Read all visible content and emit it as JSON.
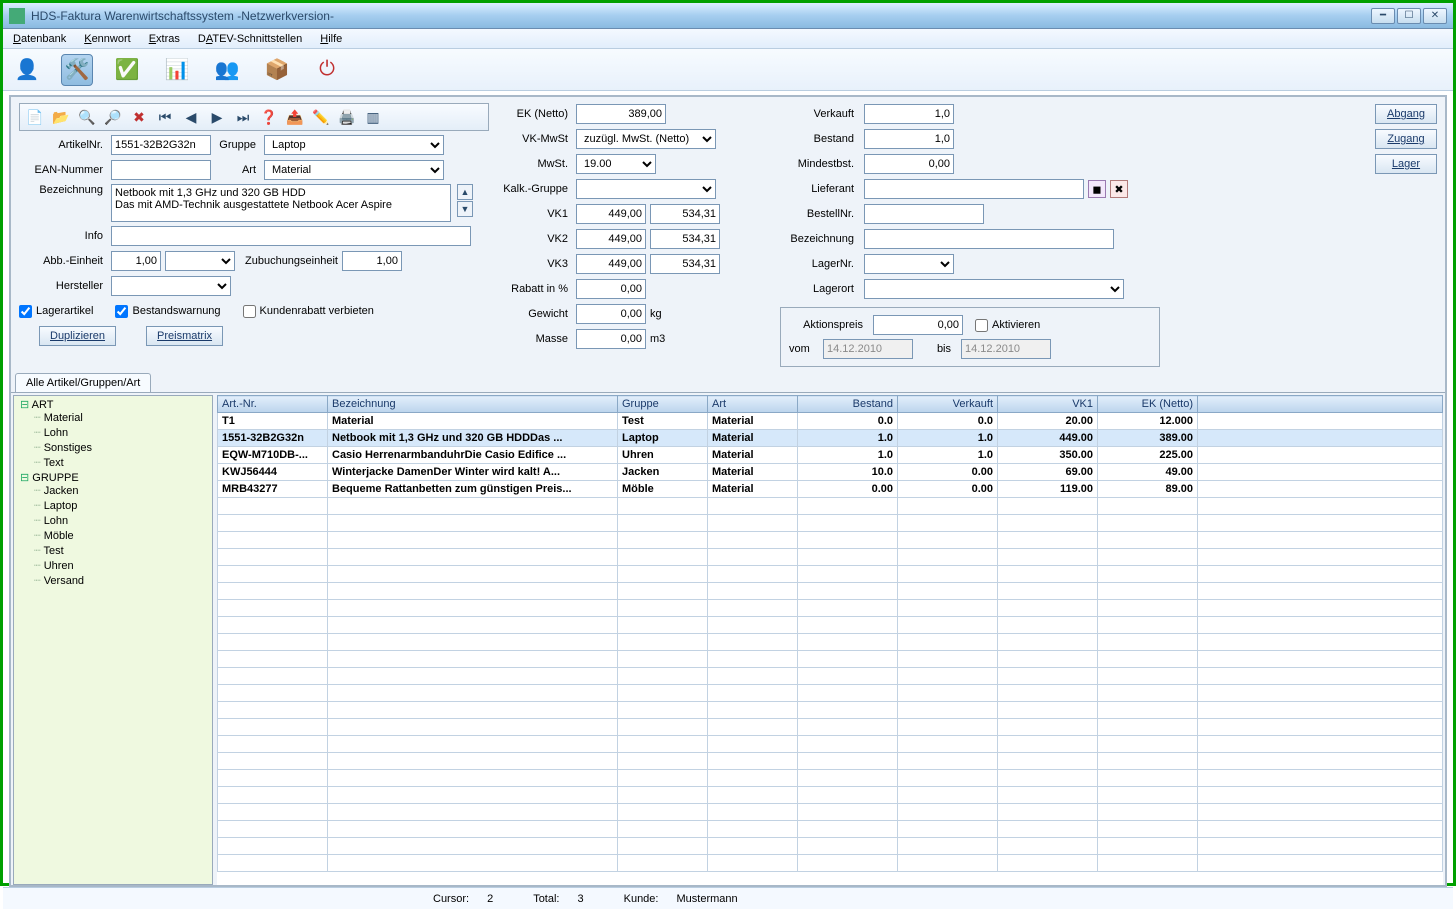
{
  "window": {
    "title": "HDS-Faktura Warenwirtschaftssystem -Netzwerkversion-"
  },
  "menu": {
    "datenbank": "Datenbank",
    "kennwort": "Kennwort",
    "extras": "Extras",
    "datev": "DATEV-Schnittstellen",
    "hilfe": "Hilfe"
  },
  "toolbar_icons": [
    "user",
    "tools",
    "check",
    "chart",
    "group",
    "package",
    "power"
  ],
  "small_toolbar_icons": [
    "new",
    "open",
    "search",
    "zoom",
    "delete",
    "first",
    "prev",
    "next",
    "last",
    "help",
    "export",
    "edit",
    "print",
    "barcode"
  ],
  "form": {
    "artikelnr_label": "ArtikelNr.",
    "artikelnr": "1551-32B2G32n",
    "gruppe_label": "Gruppe",
    "gruppe": "Laptop",
    "ean_label": "EAN-Nummer",
    "ean": "",
    "art_label": "Art",
    "art": "Material",
    "bezeichnung_label": "Bezeichnung",
    "bezeichnung": "Netbook mit 1,3 GHz und 320 GB HDD\nDas mit AMD-Technik ausgestattete Netbook Acer Aspire",
    "info_label": "Info",
    "info": "",
    "abb_einheit_label": "Abb.-Einheit",
    "abb_einheit": "1,00",
    "zubuchung_label": "Zubuchungseinheit",
    "zubuchung": "1,00",
    "hersteller_label": "Hersteller",
    "hersteller": "",
    "lagerartikel_label": "Lagerartikel",
    "bestandswarnung_label": "Bestandswarnung",
    "kundenrabatt_label": "Kundenrabatt verbieten",
    "duplizieren": "Duplizieren",
    "preismatrix": "Preismatrix"
  },
  "prices": {
    "ek_label": "EK (Netto)",
    "ek": "389,00",
    "vkmwst_label": "VK-MwSt",
    "vkmwst": "zuzügl. MwSt. (Netto)",
    "mwst_label": "MwSt.",
    "mwst": "19.00",
    "kalkgruppe_label": "Kalk.-Gruppe",
    "kalkgruppe": "",
    "vk1_label": "VK1",
    "vk1": "449,00",
    "vk1g": "534,31",
    "vk2_label": "VK2",
    "vk2": "449,00",
    "vk2g": "534,31",
    "vk3_label": "VK3",
    "vk3": "449,00",
    "vk3g": "534,31",
    "rabatt_label": "Rabatt in %",
    "rabatt": "0,00",
    "gewicht_label": "Gewicht",
    "gewicht": "0,00",
    "gewicht_unit": "kg",
    "masse_label": "Masse",
    "masse": "0,00",
    "masse_unit": "m3"
  },
  "stock": {
    "verkauft_label": "Verkauft",
    "verkauft": "1,0",
    "bestand_label": "Bestand",
    "bestand": "1,0",
    "mindestbst_label": "Mindestbst.",
    "mindestbst": "0,00",
    "lieferant_label": "Lieferant",
    "lieferant": "",
    "bestellnr_label": "BestellNr.",
    "bestellnr": "",
    "bezeichnung_label": "Bezeichnung",
    "bezeichnung": "",
    "lagernr_label": "LagerNr.",
    "lagernr": "",
    "lagerort_label": "Lagerort",
    "lagerort": "",
    "abgang": "Abgang",
    "zugang": "Zugang",
    "lager": "Lager"
  },
  "aktion": {
    "preis_label": "Aktionspreis",
    "preis": "0,00",
    "aktivieren_label": "Aktivieren",
    "vom_label": "vom",
    "vom": "14.12.2010",
    "bis_label": "bis",
    "bis": "14.12.2010"
  },
  "tab": {
    "alle": "Alle Artikel/Gruppen/Art"
  },
  "tree": {
    "art_label": "ART",
    "art": [
      "Material",
      "Lohn",
      "Sonstiges",
      "Text"
    ],
    "gruppe_label": "GRUPPE",
    "gruppe": [
      "Jacken",
      "Laptop",
      "Lohn",
      "Möble",
      "Test",
      "Uhren",
      "Versand"
    ]
  },
  "grid": {
    "headers": {
      "artnr": "Art.-Nr.",
      "bezeichnung": "Bezeichnung",
      "gruppe": "Gruppe",
      "art": "Art",
      "bestand": "Bestand",
      "verkauft": "Verkauft",
      "vk1": "VK1",
      "ek": "EK (Netto)"
    },
    "rows": [
      {
        "artnr": "T1",
        "bez": "Material",
        "gruppe": "Test",
        "art": "Material",
        "bestand": "0.0",
        "verkauft": "0.0",
        "vk1": "20.00",
        "ek": "12.000"
      },
      {
        "artnr": "1551-32B2G32n",
        "bez": "Netbook mit 1,3 GHz und 320 GB HDDDas ...",
        "gruppe": "Laptop",
        "art": "Material",
        "bestand": "1.0",
        "verkauft": "1.0",
        "vk1": "449.00",
        "ek": "389.00"
      },
      {
        "artnr": "EQW-M710DB-...",
        "bez": "Casio HerrenarmbanduhrDie Casio Edifice ...",
        "gruppe": "Uhren",
        "art": "Material",
        "bestand": "1.0",
        "verkauft": "1.0",
        "vk1": "350.00",
        "ek": "225.00"
      },
      {
        "artnr": "KWJ56444",
        "bez": "Winterjacke DamenDer Winter wird kalt! A...",
        "gruppe": "Jacken",
        "art": "Material",
        "bestand": "10.0",
        "verkauft": "0.00",
        "vk1": "69.00",
        "ek": "49.00"
      },
      {
        "artnr": "MRB43277",
        "bez": "Bequeme Rattanbetten zum günstigen Preis...",
        "gruppe": "Möble",
        "art": "Material",
        "bestand": "0.00",
        "verkauft": "0.00",
        "vk1": "119.00",
        "ek": "89.00"
      }
    ]
  },
  "status": {
    "cursor_label": "Cursor:",
    "cursor": "2",
    "total_label": "Total:",
    "total": "3",
    "kunde_label": "Kunde:",
    "kunde": "Mustermann"
  }
}
